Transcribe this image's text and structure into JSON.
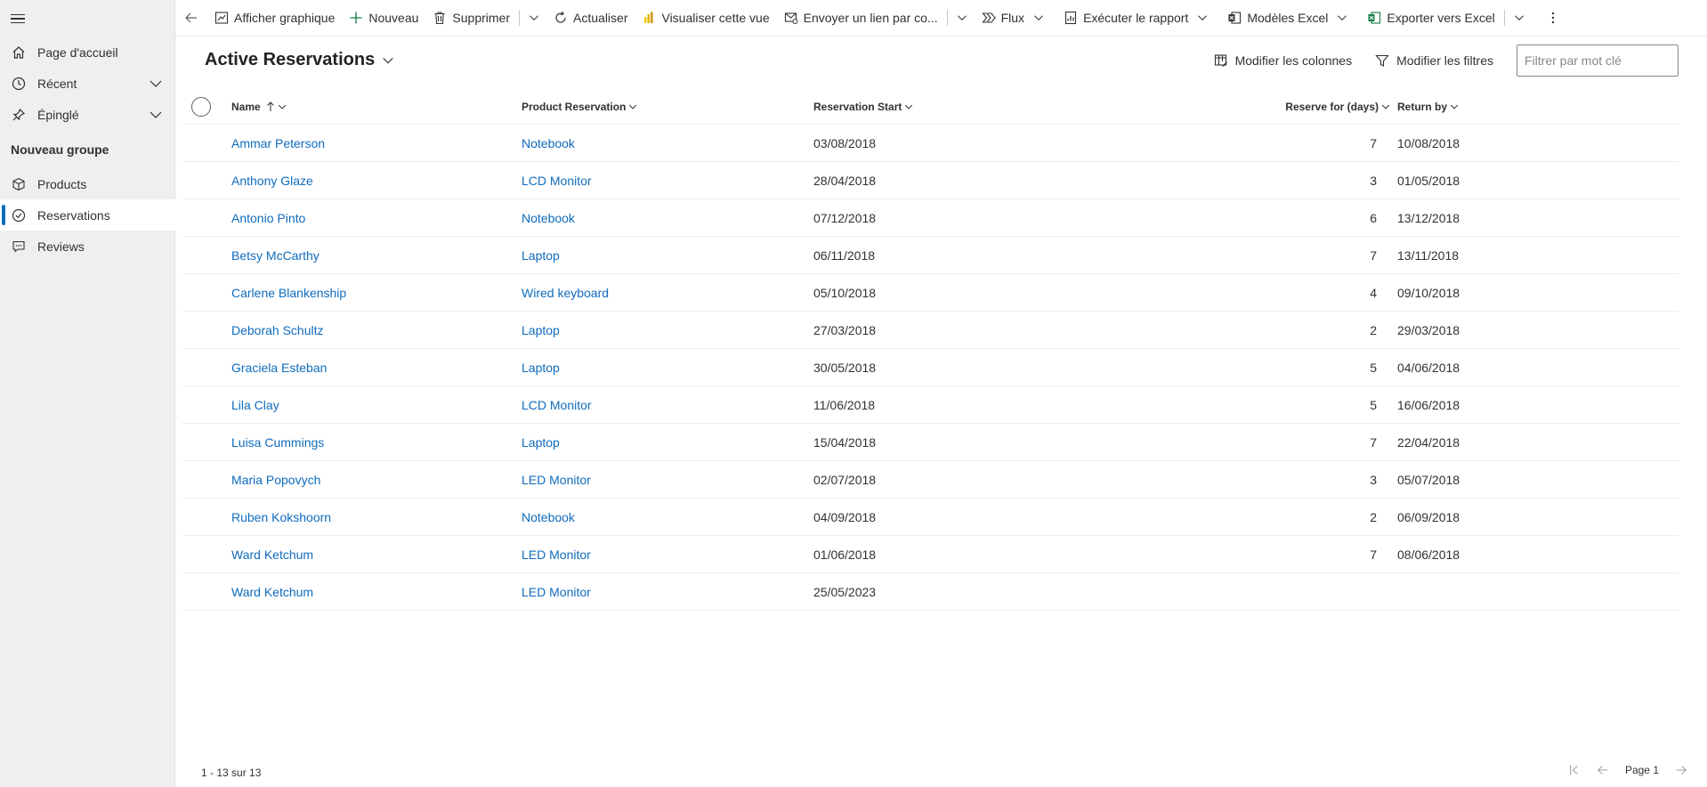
{
  "sidebar": {
    "items": [
      {
        "label": "Page d'accueil",
        "icon": "home-icon"
      },
      {
        "label": "Récent",
        "icon": "clock-icon"
      },
      {
        "label": "Épinglé",
        "icon": "pin-icon"
      }
    ],
    "group_title": "Nouveau groupe",
    "group_items": [
      {
        "label": "Products",
        "icon": "cube-icon"
      },
      {
        "label": "Reservations",
        "icon": "check-circle-icon"
      },
      {
        "label": "Reviews",
        "icon": "comment-icon"
      }
    ]
  },
  "commandbar": {
    "show_chart": "Afficher graphique",
    "new": "Nouveau",
    "delete": "Supprimer",
    "refresh": "Actualiser",
    "visualize": "Visualiser cette vue",
    "email_link": "Envoyer un lien par co...",
    "flow": "Flux",
    "run_report": "Exécuter le rapport",
    "excel_templates": "Modèles Excel",
    "export_excel": "Exporter vers Excel"
  },
  "view": {
    "title": "Active Reservations",
    "edit_columns": "Modifier les colonnes",
    "edit_filters": "Modifier les filtres",
    "search_placeholder": "Filtrer par mot clé"
  },
  "grid": {
    "columns": {
      "name": "Name",
      "product": "Product Reservation",
      "start": "Reservation Start",
      "days": "Reserve for (days)",
      "return": "Return by"
    },
    "rows": [
      {
        "name": "Ammar Peterson",
        "product": "Notebook",
        "start": "03/08/2018",
        "days": "7",
        "return": "10/08/2018"
      },
      {
        "name": "Anthony Glaze",
        "product": "LCD Monitor",
        "start": "28/04/2018",
        "days": "3",
        "return": "01/05/2018"
      },
      {
        "name": "Antonio Pinto",
        "product": "Notebook",
        "start": "07/12/2018",
        "days": "6",
        "return": "13/12/2018"
      },
      {
        "name": "Betsy McCarthy",
        "product": "Laptop",
        "start": "06/11/2018",
        "days": "7",
        "return": "13/11/2018"
      },
      {
        "name": "Carlene Blankenship",
        "product": "Wired keyboard",
        "start": "05/10/2018",
        "days": "4",
        "return": "09/10/2018"
      },
      {
        "name": "Deborah Schultz",
        "product": "Laptop",
        "start": "27/03/2018",
        "days": "2",
        "return": "29/03/2018"
      },
      {
        "name": "Graciela Esteban",
        "product": "Laptop",
        "start": "30/05/2018",
        "days": "5",
        "return": "04/06/2018"
      },
      {
        "name": "Lila Clay",
        "product": "LCD Monitor",
        "start": "11/06/2018",
        "days": "5",
        "return": "16/06/2018"
      },
      {
        "name": "Luisa Cummings",
        "product": "Laptop",
        "start": "15/04/2018",
        "days": "7",
        "return": "22/04/2018"
      },
      {
        "name": "Maria Popovych",
        "product": "LED Monitor",
        "start": "02/07/2018",
        "days": "3",
        "return": "05/07/2018"
      },
      {
        "name": "Ruben Kokshoorn",
        "product": "Notebook",
        "start": "04/09/2018",
        "days": "2",
        "return": "06/09/2018"
      },
      {
        "name": "Ward Ketchum",
        "product": "LED Monitor",
        "start": "01/06/2018",
        "days": "7",
        "return": "08/06/2018"
      },
      {
        "name": "Ward Ketchum",
        "product": "LED Monitor",
        "start": "25/05/2023",
        "days": "",
        "return": ""
      }
    ]
  },
  "footer": {
    "count": "1 - 13 sur 13",
    "page": "Page 1"
  },
  "colors": {
    "accent": "#0f6cbd",
    "sidebar_bg": "#efefef",
    "excel_green": "#107c41",
    "powerbi_yellow": "#f2c811"
  }
}
